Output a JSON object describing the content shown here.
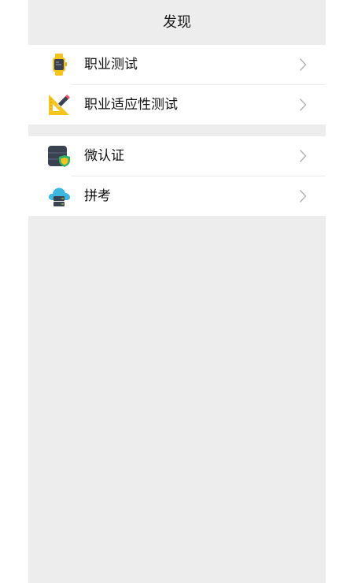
{
  "header": {
    "title": "发现"
  },
  "groups": [
    {
      "items": [
        {
          "label": "职业测试",
          "icon": "smartwatch-icon"
        },
        {
          "label": "职业适应性测试",
          "icon": "ruler-pencil-icon"
        }
      ]
    },
    {
      "items": [
        {
          "label": "微认证",
          "icon": "database-shield-icon"
        },
        {
          "label": "拼考",
          "icon": "cloud-server-icon"
        }
      ]
    }
  ],
  "colors": {
    "background": "#ededed",
    "card": "#ffffff",
    "text": "#111111",
    "chevron": "#b2b2b2",
    "watch_yellow": "#f5c31c",
    "ruler_yellow": "#f7c51e",
    "db_dark": "#3a4150",
    "shield_green": "#2fb36a",
    "cloud_blue": "#3cb7e0"
  }
}
